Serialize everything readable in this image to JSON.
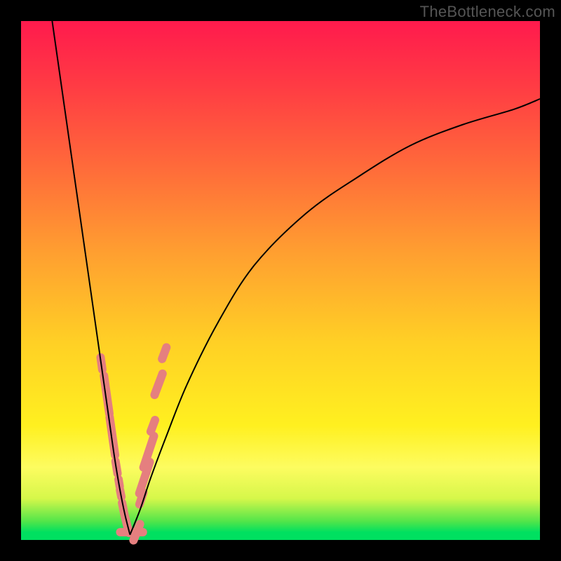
{
  "watermark": "TheBottleneck.com",
  "colors": {
    "frame_bg": "#000000",
    "bead": "#e57f7f",
    "curve": "#000000",
    "gradient_stops": [
      "#ff1a4d",
      "#ff3a44",
      "#ff6a3a",
      "#ffa030",
      "#ffd025",
      "#fff020",
      "#fdfc60",
      "#d6f74a",
      "#4fe54a",
      "#00e060"
    ]
  },
  "chart_data": {
    "type": "line",
    "title": "",
    "xlabel": "",
    "ylabel": "",
    "xlim": [
      0,
      100
    ],
    "ylim": [
      0,
      100
    ],
    "note": "Bottleneck-style V-curve: two curves meeting at the bottom around x≈21. Left branch descends steeply from top-left; right branch rises with decreasing slope toward upper-right. y-axis likely bottleneck %, x-axis likely hardware/perf ratio. No axis ticks or labels rendered in image.",
    "series": [
      {
        "name": "left-branch",
        "x": [
          6,
          8,
          10,
          12,
          14,
          15,
          16,
          17,
          18,
          19,
          20,
          21
        ],
        "values": [
          100,
          86,
          72,
          58,
          44,
          37,
          30,
          23,
          16,
          10,
          5,
          1
        ]
      },
      {
        "name": "right-branch",
        "x": [
          21,
          23,
          25,
          28,
          32,
          38,
          45,
          55,
          65,
          75,
          85,
          95,
          100
        ],
        "values": [
          1,
          6,
          12,
          20,
          30,
          42,
          53,
          63,
          70,
          76,
          80,
          83,
          85
        ]
      }
    ],
    "markers": {
      "name": "salmon-beads",
      "note": "Clustered near the trough on both branches, elongated capsule shapes.",
      "points": [
        {
          "x": 15.5,
          "y": 34,
          "len": 4
        },
        {
          "x": 16.5,
          "y": 28,
          "len": 9
        },
        {
          "x": 17.6,
          "y": 20,
          "len": 9
        },
        {
          "x": 18.4,
          "y": 14,
          "len": 4
        },
        {
          "x": 18.9,
          "y": 11,
          "len": 3
        },
        {
          "x": 19.2,
          "y": 9,
          "len": 3
        },
        {
          "x": 19.7,
          "y": 6,
          "len": 4
        },
        {
          "x": 20.4,
          "y": 3,
          "len": 5
        },
        {
          "x": 21.3,
          "y": 1.5,
          "len": 6
        },
        {
          "x": 22.3,
          "y": 1.5,
          "len": 5
        },
        {
          "x": 23.2,
          "y": 8,
          "len": 4
        },
        {
          "x": 23.8,
          "y": 12,
          "len": 8
        },
        {
          "x": 24.6,
          "y": 17,
          "len": 8
        },
        {
          "x": 25.4,
          "y": 22,
          "len": 4
        },
        {
          "x": 26.5,
          "y": 30,
          "len": 6
        },
        {
          "x": 27.6,
          "y": 36,
          "len": 4
        }
      ]
    }
  }
}
